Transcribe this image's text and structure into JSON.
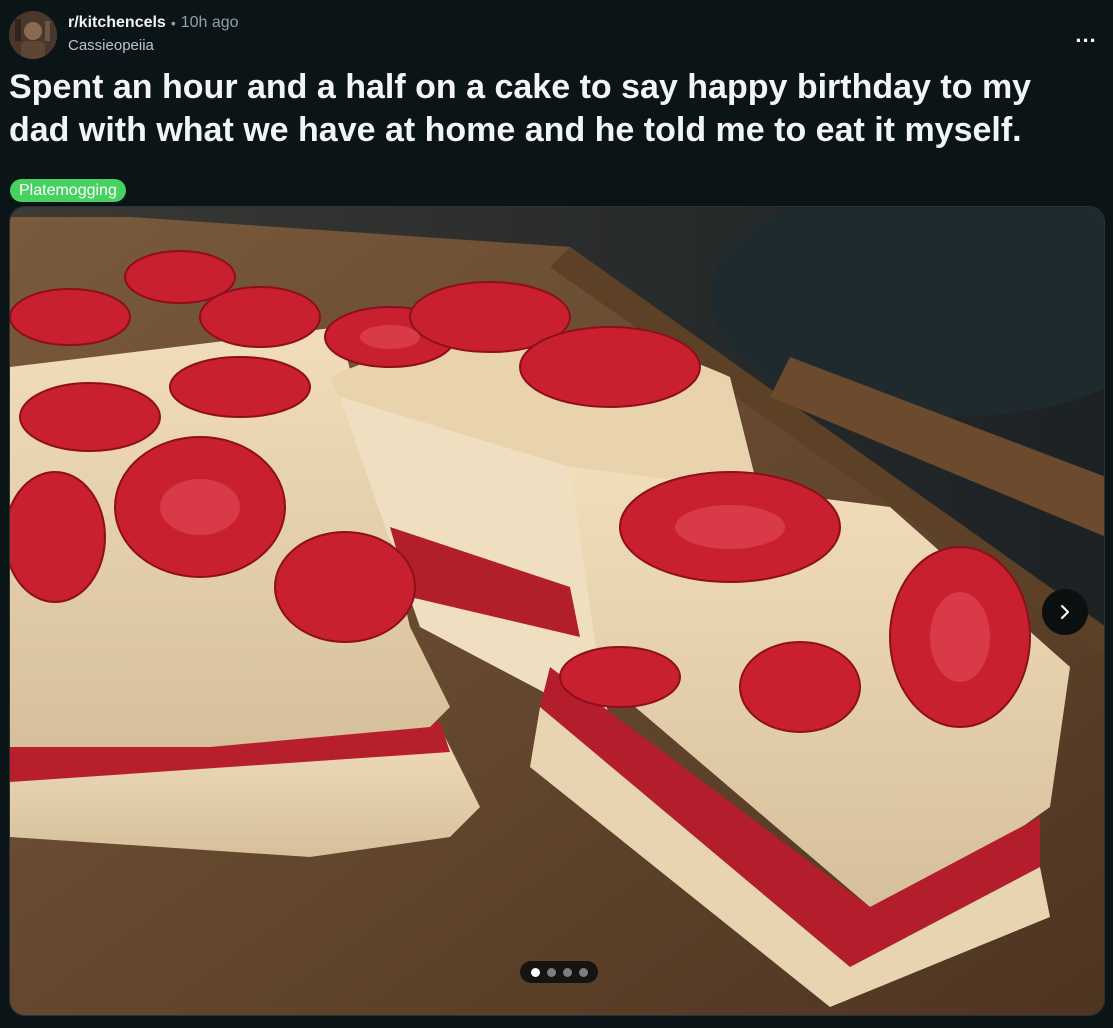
{
  "header": {
    "subreddit": "r/kitchencels",
    "separator": "•",
    "time_ago": "10h ago",
    "author": "Cassieopeiia",
    "more_label": "..."
  },
  "post": {
    "title": "Spent an hour and a half on a cake to say happy birthday to my dad with what we have at home and he told me to eat it myself.",
    "flair": "Platemogging",
    "flair_color": "#46d160"
  },
  "gallery": {
    "image_count": 4,
    "current_index": 1,
    "next_icon": "chevron-right-icon"
  },
  "colors": {
    "background": "#0b1416",
    "text_primary": "#f2f4f5",
    "text_secondary": "#8ba2ad"
  }
}
